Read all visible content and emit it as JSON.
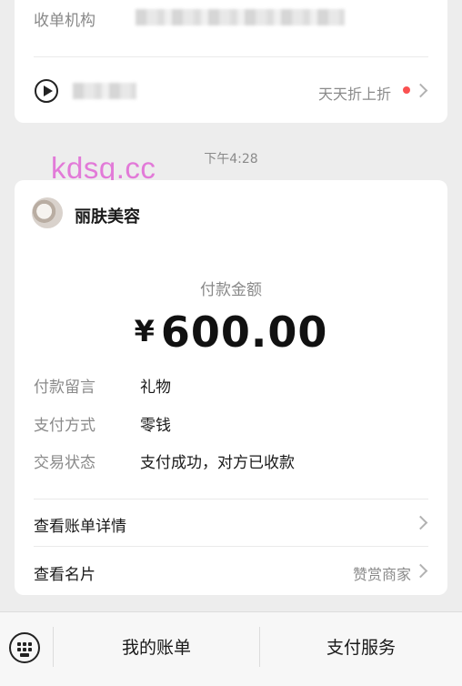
{
  "top_card": {
    "org_label": "收单机构",
    "promo_text": "天天折上折"
  },
  "timestamp": "下午4:28",
  "watermark": "kdsq.cc",
  "payment_card": {
    "merchant_name": "丽肤美容",
    "amount_label": "付款金额",
    "currency": "¥",
    "amount": "600.00",
    "details": [
      {
        "label": "付款留言",
        "value": "礼物"
      },
      {
        "label": "支付方式",
        "value": "零钱"
      },
      {
        "label": "交易状态",
        "value": "支付成功，对方已收款"
      }
    ],
    "links": [
      {
        "label": "查看账单详情",
        "right": ""
      },
      {
        "label": "查看名片",
        "right": "赞赏商家"
      }
    ]
  },
  "bottom_bar": {
    "tabs": [
      "我的账单",
      "支付服务"
    ]
  }
}
